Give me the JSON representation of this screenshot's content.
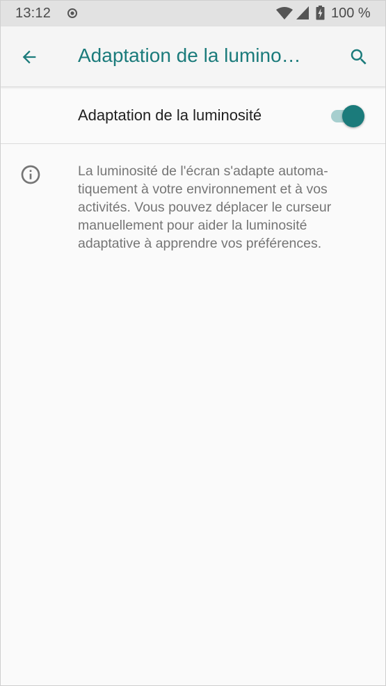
{
  "status_bar": {
    "time": "13:12",
    "battery": "100 %",
    "icons": [
      "record-icon",
      "wifi-icon",
      "signal-icon",
      "battery-charging-icon"
    ]
  },
  "app_bar": {
    "title": "Adaptation de la lumino…",
    "back_icon": "arrow-back-icon",
    "search_icon": "search-icon"
  },
  "setting": {
    "label": "Adaptation de la luminosité",
    "enabled": true
  },
  "info": {
    "icon": "info-icon",
    "lines": [
      "La luminosité de l'écran s'adapte automa-",
      "tiquement à votre environnement et à vos",
      "activités. Vous pouvez déplacer le curseur",
      "manuellement pour aider la luminosité",
      "adaptative à apprendre vos préférences."
    ]
  },
  "colors": {
    "accent": "#1b7b7b",
    "accent_light": "#a7cfcf",
    "status_bar_bg": "#e2e2e2",
    "background": "#fafafa"
  }
}
